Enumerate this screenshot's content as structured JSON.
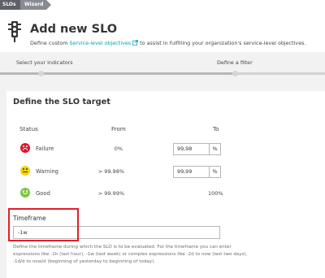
{
  "breadcrumb": [
    "SLOs",
    "Wizard"
  ],
  "header": {
    "title": "Add new SLO",
    "subtitle_prefix": "Define custom ",
    "subtitle_link": "Service-level objectives",
    "subtitle_suffix": " to assist in fulfilling your organization's service-level objectives."
  },
  "wizard": {
    "steps": [
      "Select your indicators",
      "Define a filter"
    ],
    "progress": 0.72
  },
  "target": {
    "title": "Define the SLO target",
    "headers": {
      "status": "Status",
      "from": "From",
      "to": "To"
    },
    "rows": [
      {
        "label": "Failure",
        "from": "0%",
        "to_value": "99,98",
        "to_unit": "%"
      },
      {
        "label": "Warning",
        "from": "> 99.98%",
        "to_value": "99,99",
        "to_unit": "%"
      },
      {
        "label": "Good",
        "from": "> 99.99%",
        "to_static": "100%"
      }
    ],
    "status_colors": {
      "failure": "#dc172a",
      "warning": "#f5d30f",
      "good": "#7dc540"
    }
  },
  "timeframe": {
    "label": "Timeframe",
    "value": "-1w",
    "help": "Define the timeframe during which the SLO is to be evaluated. For the timeframe you can enter expressions like -1h (last hour), -1w (last week) or complex expressions like -2d to now (last two days), -1d/d to now/d (beginning of yesterday to beginning of today)."
  },
  "colors": {
    "accent": "#00a1b2",
    "highlight": "#e0202a"
  }
}
